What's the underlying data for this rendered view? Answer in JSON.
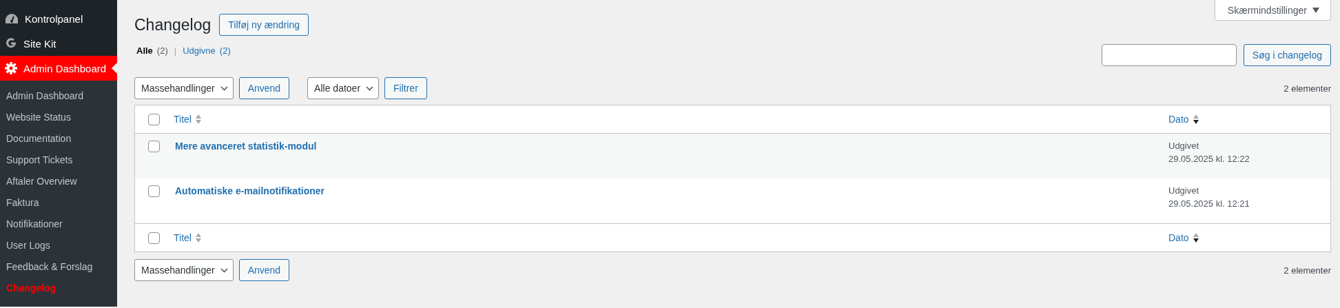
{
  "sidebar": {
    "menu": [
      {
        "label": "Kontrolpanel",
        "kind": "gauge",
        "selected": false
      },
      {
        "label": "Site Kit",
        "kind": "g",
        "selected": false
      },
      {
        "label": "Admin Dashboard",
        "kind": "gear",
        "selected": true
      }
    ],
    "submenu": [
      {
        "label": "Admin Dashboard",
        "selected": false
      },
      {
        "label": "Website Status",
        "selected": false
      },
      {
        "label": "Documentation",
        "selected": false
      },
      {
        "label": "Support Tickets",
        "selected": false
      },
      {
        "label": "Aftaler Overview",
        "selected": false
      },
      {
        "label": "Faktura",
        "selected": false
      },
      {
        "label": "Notifikationer",
        "selected": false
      },
      {
        "label": "User Logs",
        "selected": false
      },
      {
        "label": "Feedback & Forslag",
        "selected": false
      },
      {
        "label": "Changelog",
        "selected": true
      }
    ]
  },
  "screen_options": "Skærmindstillinger",
  "page_title": "Changelog",
  "add_button": "Tilføj ny ændring",
  "views": [
    {
      "label": "Alle",
      "count": "(2)",
      "selected": true
    },
    {
      "label": "Udgivne",
      "count": "(2)",
      "selected": false
    }
  ],
  "views_separator": "|",
  "search": {
    "button": "Søg i changelog"
  },
  "top_toolbar": {
    "bulk_select": "Massehandlinger",
    "apply": "Anvend",
    "date_select": "Alle datoer",
    "filter": "Filtrer",
    "count": "2 elementer"
  },
  "table": {
    "header_checked": false,
    "columns": [
      {
        "label": "Titel",
        "sorted": false
      },
      {
        "label": "Dato",
        "sorted": true
      }
    ],
    "rows": [
      {
        "checked": false,
        "title": "Mere avanceret statistik-modul",
        "status": "Udgivet",
        "date": "29.05.2025 kl. 12:22"
      },
      {
        "checked": false,
        "title": "Automatiske e-mailnotifikationer",
        "status": "Udgivet",
        "date": "29.05.2025 kl. 12:21"
      }
    ],
    "footer_checked": false,
    "footer_columns": [
      {
        "label": "Titel",
        "sorted": false
      },
      {
        "label": "Dato",
        "sorted": true
      }
    ]
  },
  "bottom_toolbar": {
    "bulk_select": "Massehandlinger",
    "apply": "Anvend",
    "count": "2 elementer"
  }
}
